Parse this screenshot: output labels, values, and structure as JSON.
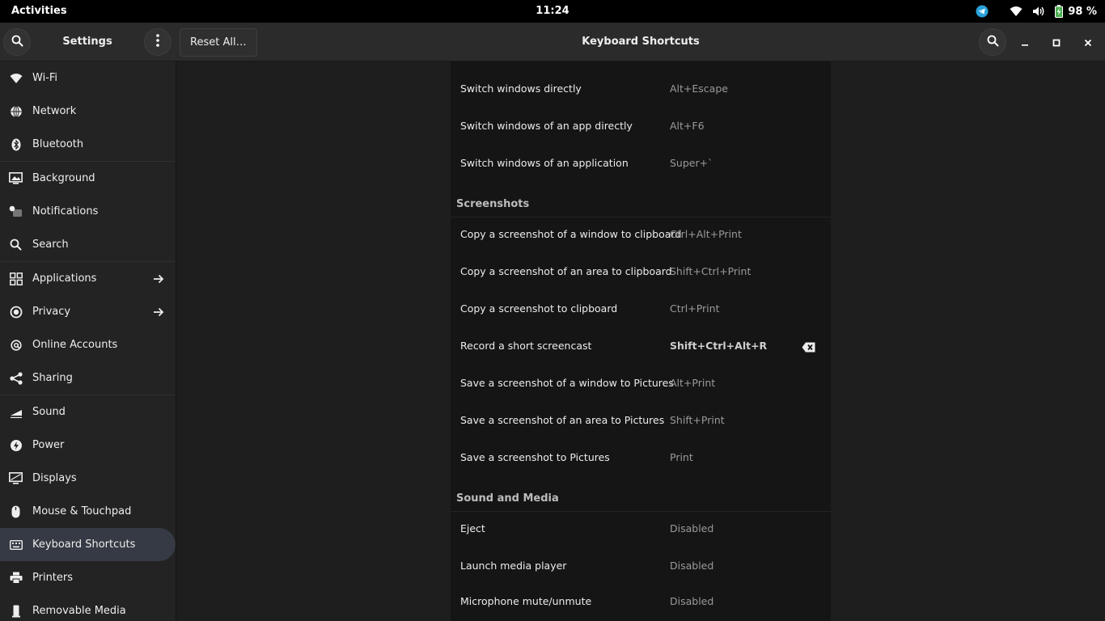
{
  "top_panel": {
    "activities": "Activities",
    "clock": "11:24",
    "battery_percent": "98 %"
  },
  "header": {
    "sidebar_title": "Settings",
    "reset_button": "Reset All…",
    "page_title": "Keyboard Shortcuts"
  },
  "sidebar": {
    "items": [
      {
        "label": "Wi-Fi"
      },
      {
        "label": "Network"
      },
      {
        "label": "Bluetooth"
      },
      {
        "label": "Background"
      },
      {
        "label": "Notifications"
      },
      {
        "label": "Search"
      },
      {
        "label": "Applications"
      },
      {
        "label": "Privacy"
      },
      {
        "label": "Online Accounts"
      },
      {
        "label": "Sharing"
      },
      {
        "label": "Sound"
      },
      {
        "label": "Power"
      },
      {
        "label": "Displays"
      },
      {
        "label": "Mouse & Touchpad"
      },
      {
        "label": "Keyboard Shortcuts"
      },
      {
        "label": "Printers"
      },
      {
        "label": "Removable Media"
      }
    ]
  },
  "shortcuts": {
    "navigation_rows": [
      {
        "label": "Switch windows directly",
        "accel": "Alt+Escape"
      },
      {
        "label": "Switch windows of an app directly",
        "accel": "Alt+F6"
      },
      {
        "label": "Switch windows of an application",
        "accel": "Super+`"
      }
    ],
    "screenshots": {
      "title": "Screenshots",
      "rows": [
        {
          "label": "Copy a screenshot of a window to clipboard",
          "accel": "Ctrl+Alt+Print"
        },
        {
          "label": "Copy a screenshot of an area to clipboard",
          "accel": "Shift+Ctrl+Print"
        },
        {
          "label": "Copy a screenshot to clipboard",
          "accel": "Ctrl+Print"
        },
        {
          "label": "Record a short screencast",
          "accel": "Shift+Ctrl+Alt+R"
        },
        {
          "label": "Save a screenshot of a window to Pictures",
          "accel": "Alt+Print"
        },
        {
          "label": "Save a screenshot of an area to Pictures",
          "accel": "Shift+Print"
        },
        {
          "label": "Save a screenshot to Pictures",
          "accel": "Print"
        }
      ]
    },
    "sound_media": {
      "title": "Sound and Media",
      "rows": [
        {
          "label": "Eject",
          "accel": "Disabled"
        },
        {
          "label": "Launch media player",
          "accel": "Disabled"
        },
        {
          "label": "Microphone mute/unmute",
          "accel": "Disabled"
        }
      ]
    }
  },
  "colors": {
    "accent_active": "#353a44",
    "battery_green": "#4caf50",
    "telegram_blue": "#2aa1da"
  }
}
